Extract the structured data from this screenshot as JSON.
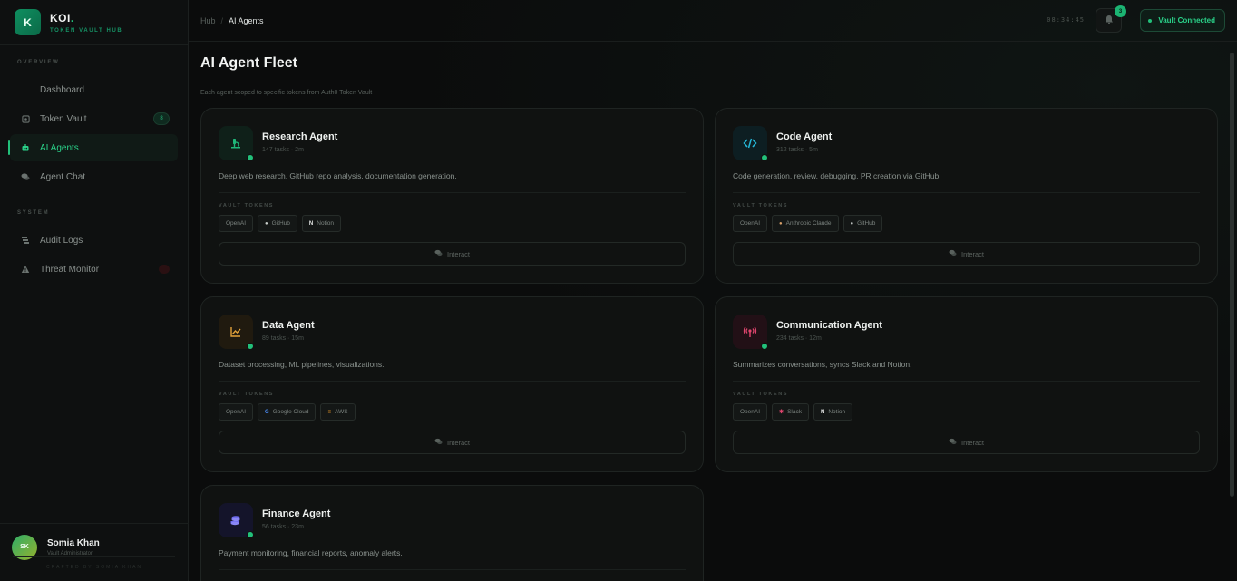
{
  "brand": {
    "initial": "K",
    "name": "KOI",
    "dot": ".",
    "subtitle": "TOKEN VAULT HUB"
  },
  "sidebar": {
    "sections": [
      {
        "label": "OVERVIEW"
      },
      {
        "label": "SYSTEM"
      }
    ],
    "items": [
      {
        "label": "Dashboard",
        "icon": "dashboard-icon"
      },
      {
        "label": "Token Vault",
        "icon": "vault-icon",
        "badge": "8"
      },
      {
        "label": "AI Agents",
        "icon": "robot-icon",
        "active": true
      },
      {
        "label": "Agent Chat",
        "icon": "chat-icon"
      },
      {
        "label": "Audit Logs",
        "icon": "logs-icon"
      },
      {
        "label": "Threat Monitor",
        "icon": "warning-icon"
      }
    ],
    "user": {
      "initials": "SK",
      "name": "Somia Khan",
      "role": "Vault Administrator"
    },
    "footer": "CRAFTED BY SOMIA KHAN"
  },
  "topbar": {
    "breadcrumb": {
      "root": "Hub",
      "separator": "/",
      "current": "AI Agents"
    },
    "clock": "08:34:45",
    "notifications": "3",
    "vault_status": "Vault Connected"
  },
  "page": {
    "title": "AI Agent Fleet",
    "subtitle": "Each agent scoped to specific tokens from Auth0 Token Vault",
    "vault_tokens_label": "VAULT TOKENS",
    "interact_label": "Interact"
  },
  "agents": [
    {
      "name": "Research Agent",
      "meta": "147 tasks · 2m",
      "description": "Deep web research, GitHub repo analysis, documentation generation.",
      "icon": "research-icon",
      "accent": "#1fb77a",
      "tokens": [
        {
          "label": "OpenAI"
        },
        {
          "label": "GitHub",
          "icon": "github-icon"
        },
        {
          "label": "Notion",
          "icon": "notion-icon"
        }
      ]
    },
    {
      "name": "Code Agent",
      "meta": "312 tasks · 5m",
      "description": "Code generation, review, debugging, PR creation via GitHub.",
      "icon": "code-icon",
      "accent": "#25b6d6",
      "tokens": [
        {
          "label": "OpenAI"
        },
        {
          "label": "Anthropic Claude",
          "icon": "anthropic-icon"
        },
        {
          "label": "GitHub",
          "icon": "github-icon"
        }
      ]
    },
    {
      "name": "Data Agent",
      "meta": "89 tasks · 15m",
      "description": "Dataset processing, ML pipelines, visualizations.",
      "icon": "chart-line-icon",
      "accent": "#e2a23a",
      "tokens": [
        {
          "label": "OpenAI"
        },
        {
          "label": "Google Cloud",
          "icon": "google-icon"
        },
        {
          "label": "AWS",
          "icon": "aws-icon"
        }
      ]
    },
    {
      "name": "Communication Agent",
      "meta": "234 tasks · 12m",
      "description": "Summarizes conversations, syncs Slack and Notion.",
      "icon": "broadcast-icon",
      "accent": "#e0456e",
      "tokens": [
        {
          "label": "OpenAI"
        },
        {
          "label": "Slack",
          "icon": "slack-icon"
        },
        {
          "label": "Notion",
          "icon": "notion-icon"
        }
      ]
    },
    {
      "name": "Finance Agent",
      "meta": "56 tasks · 23m",
      "description": "Payment monitoring, financial reports, anomaly alerts.",
      "icon": "coins-icon",
      "accent": "#6f6cf0",
      "tokens": []
    }
  ]
}
